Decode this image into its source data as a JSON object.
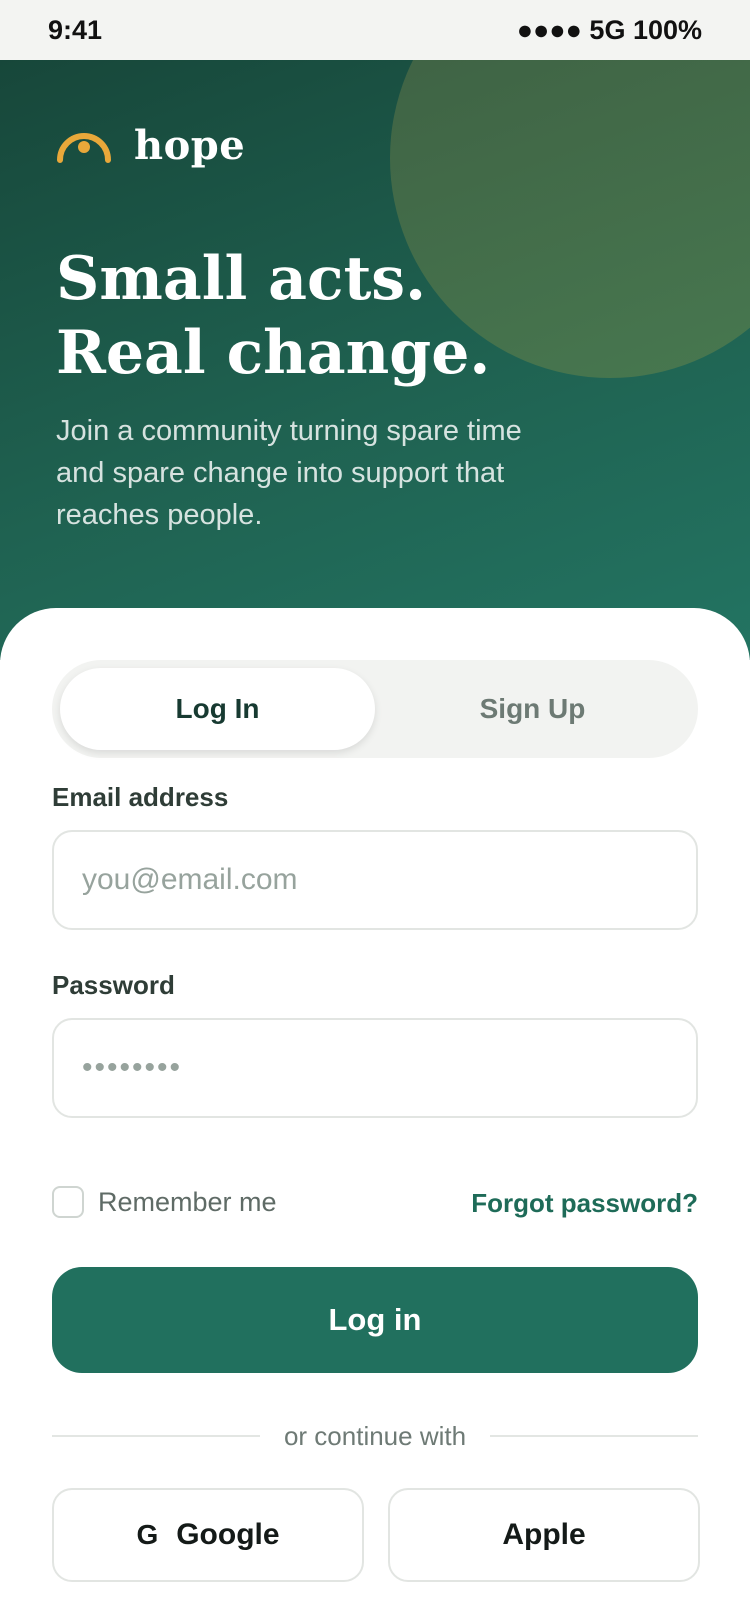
{
  "status_bar": {
    "time": "9:41",
    "indicators": "●●●● 5G 100%"
  },
  "brand": {
    "name": "hope",
    "logo_icon": "rising-sun-icon",
    "logo_color": "#e9a83a"
  },
  "hero": {
    "headline_line1": "Small acts.",
    "headline_line2": "Real change.",
    "subcopy": "Join a community turning spare time and spare change into support that reaches people."
  },
  "auth_tabs": {
    "login_label": "Log In",
    "signup_label": "Sign Up",
    "active": "Log In"
  },
  "form": {
    "email_label": "Email address",
    "email_placeholder": "you@email.com",
    "email_value": "",
    "password_label": "Password",
    "password_placeholder": "••••••••",
    "password_value": "",
    "remember_label": "Remember me",
    "remember_checked": false,
    "forgot_label": "Forgot password?",
    "submit_label": "Log in"
  },
  "social": {
    "divider_text": "or continue with",
    "google_glyph": "G",
    "google_label": "Google",
    "apple_label": "Apple"
  },
  "colors": {
    "primary": "#21705e",
    "hero_dark": "#17473a",
    "accent": "#e9a83a"
  }
}
